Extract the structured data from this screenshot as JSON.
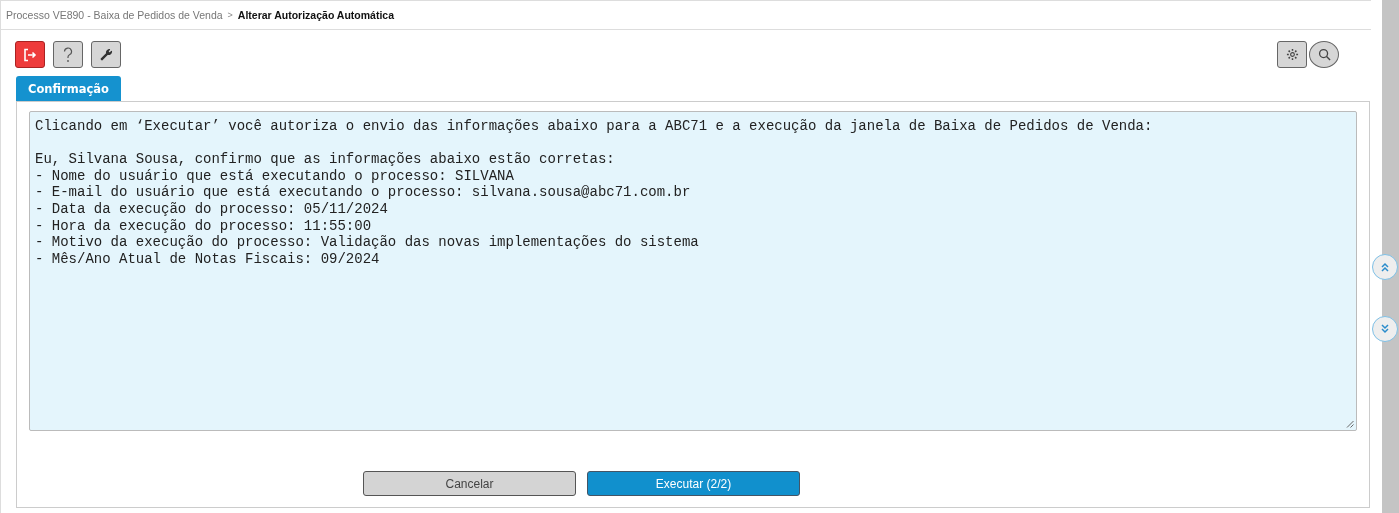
{
  "breadcrumb": {
    "parent": "Processo VE890 - Baixa de Pedidos de Venda",
    "separator": ">",
    "current": "Alterar Autorização Automática"
  },
  "tabs": [
    {
      "label": "Confirmação",
      "selected": true
    }
  ],
  "intro": "Clicando em ‘Executar’ você autoriza o envio das informações abaixo para a ABC71 e a execução da janela de Baixa de Pedidos de Venda:",
  "message_lines": [
    "Eu, Silvana Sousa, confirmo que as informações abaixo estão corretas:",
    "- Nome do usuário que está executando o processo: SILVANA",
    "- E-mail do usuário que está executando o processo: silvana.sousa@abc71.com.br",
    "- Data da execução do processo: 05/11/2024",
    "- Hora da execução do processo: 11:55:00",
    "- Motivo da execução do processo: Validação das novas implementações do sistema",
    "- Mês/Ano Atual de Notas Fiscais: 09/2024"
  ],
  "buttons": [
    {
      "label": "Cancelar",
      "kind": "secondary"
    },
    {
      "label": "Executar (2/2)",
      "kind": "primary"
    }
  ]
}
